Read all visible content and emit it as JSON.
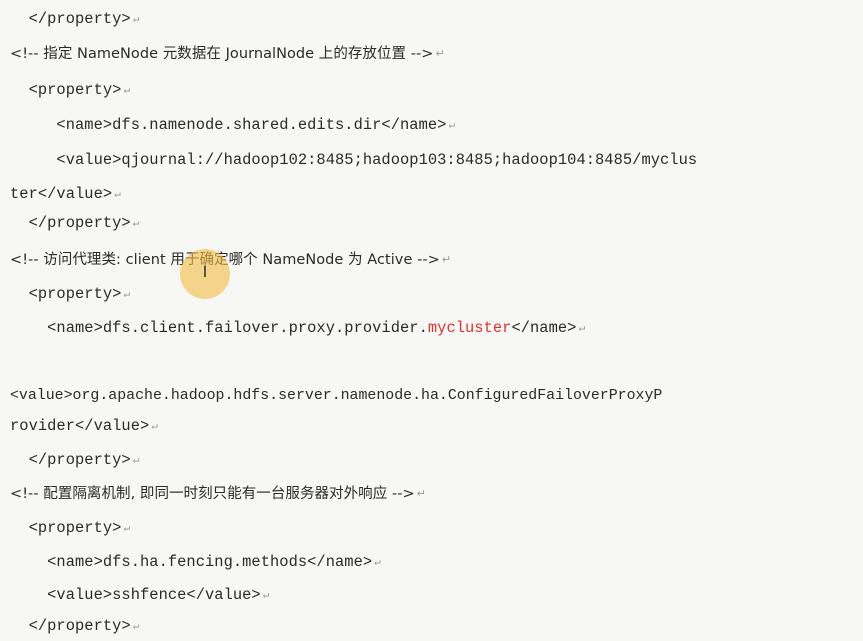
{
  "lines": [
    {
      "text": "  </property>"
    },
    {
      "text": "<!-- 指定 NameNode 元数据在 JournalNode 上的存放位置 -->"
    },
    {
      "text": "  <property>"
    },
    {
      "text": "     <name>dfs.namenode.shared.edits.dir</name>"
    },
    {
      "text": "     <value>qjournal://hadoop102:8485;hadoop103:8485;hadoop104:8485/myclus"
    },
    {
      "text": "ter</value>"
    },
    {
      "text": "  </property>"
    },
    {
      "text": "<!-- 访问代理类: client 用于确定哪个 NameNode 为 Active -->"
    },
    {
      "text": "  <property>"
    },
    {
      "text_before": "    <name>dfs.client.failover.proxy.provider.",
      "text_accent": "mycluster",
      "text_after": "</name>"
    },
    {
      "text": "<value>org.apache.hadoop.hdfs.server.namenode.ha.ConfiguredFailoverProxyP"
    },
    {
      "text": "rovider</value>"
    },
    {
      "text": "  </property>"
    },
    {
      "text": "<!-- 配置隔离机制, 即同一时刻只能有一台服务器对外响应 -->"
    },
    {
      "text": "  <property>"
    },
    {
      "text": "    <name>dfs.ha.fencing.methods</name>"
    },
    {
      "text": "    <value>sshfence</value>"
    },
    {
      "text": "  </property>"
    }
  ],
  "return_mark": "↵",
  "cursor_glyph": "I",
  "colors": {
    "text": "#2a2a2a",
    "accent": "#e0322f",
    "background": "#f7f7f5",
    "cursor_highlight": "#f2be48"
  }
}
